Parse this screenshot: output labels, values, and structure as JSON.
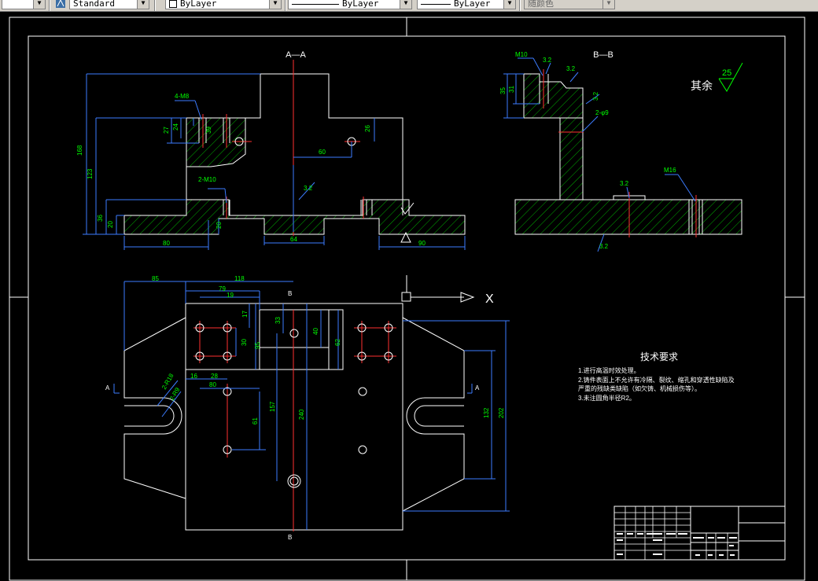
{
  "toolbar": {
    "text_style": "Standard",
    "layer": "ByLayer",
    "linetype": "ByLayer",
    "lineweight": "ByLayer",
    "plot_style": "随颜色"
  },
  "drawing": {
    "section_aa": "A—A",
    "section_bb": "B—B",
    "roughness_note": "其余",
    "roughness_value": "25",
    "tech_title": "技术要求",
    "tech_lines": [
      "1.进行高温时效处理。",
      "2.铸件表面上不允许有冷隔、裂纹、缩孔和穿透性缺陷及",
      "严重的残缺类缺陷（如欠铸、机械损伤等）。",
      "3.未注圆角半径R2。"
    ],
    "labels": {
      "d_4m8": "4-M8",
      "d_2m10": "2-M10",
      "d_m10": "M10",
      "d_2phi9": "2-φ9",
      "d_m16": "M16",
      "d_2r18": "2-R18",
      "d_2r9": "2-R9",
      "rough_32": "3.2",
      "d_168": "168",
      "d_123": "123",
      "d_36": "36",
      "d_20": "20",
      "d_27": "27",
      "d_24": "24",
      "d_39": "39",
      "d_26": "26",
      "d_60": "60",
      "d_80": "80",
      "d_64": "64",
      "d_90": "90",
      "d_35": "35",
      "d_31": "31",
      "d_85": "85",
      "d_118": "118",
      "d_79": "79",
      "d_19": "19",
      "d_17": "17",
      "d_33": "33",
      "d_40": "40",
      "d_62": "62",
      "d_30": "30",
      "d_95": "95",
      "d_16": "16",
      "d_28": "28",
      "d_157": "157",
      "d_240": "240",
      "d_61": "61",
      "d_132": "132",
      "d_202": "202",
      "sec_a": "A",
      "sec_b": "B",
      "axis_x": "X"
    }
  }
}
